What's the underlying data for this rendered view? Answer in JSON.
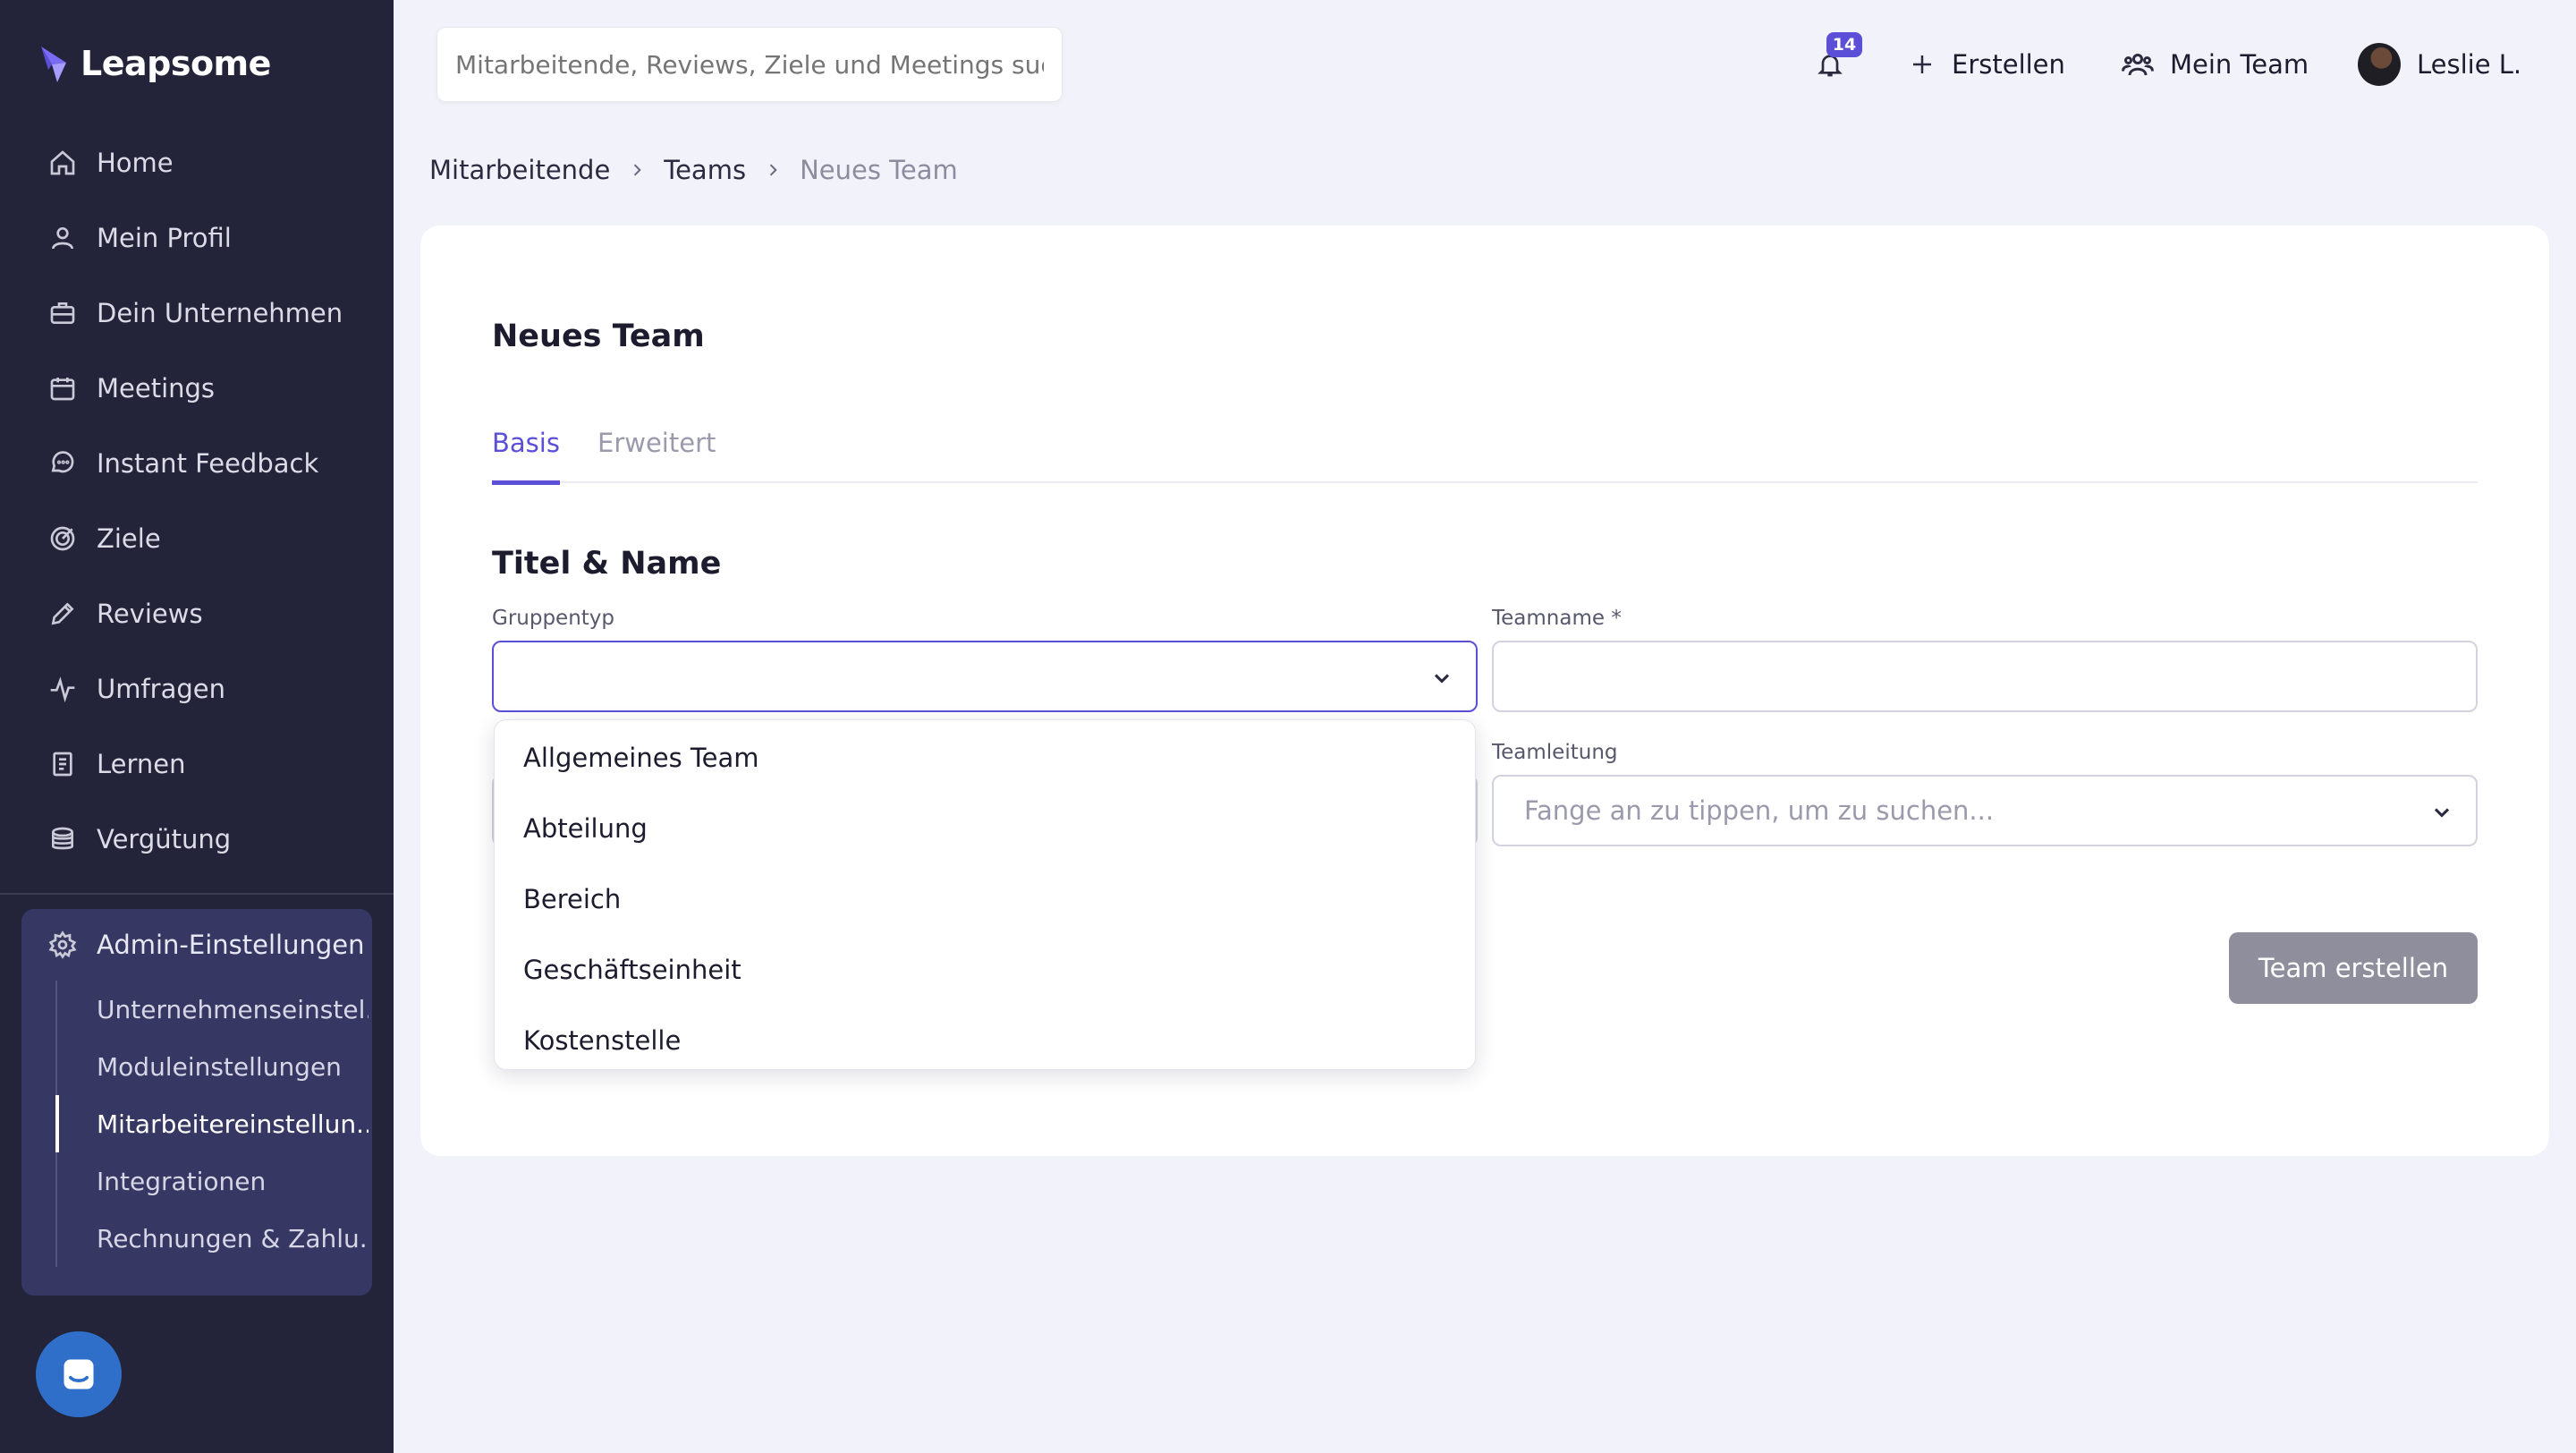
{
  "brand": {
    "name": "Leapsome"
  },
  "sidebar": {
    "items": [
      {
        "label": "Home",
        "icon": "home-icon"
      },
      {
        "label": "Mein Profil",
        "icon": "user-icon"
      },
      {
        "label": "Dein Unternehmen",
        "icon": "briefcase-icon"
      },
      {
        "label": "Meetings",
        "icon": "calendar-icon"
      },
      {
        "label": "Instant Feedback",
        "icon": "chat-bubble-icon"
      },
      {
        "label": "Ziele",
        "icon": "target-icon"
      },
      {
        "label": "Reviews",
        "icon": "pencil-icon"
      },
      {
        "label": "Umfragen",
        "icon": "pulse-icon"
      },
      {
        "label": "Lernen",
        "icon": "book-icon"
      },
      {
        "label": "Vergütung",
        "icon": "coins-icon"
      }
    ],
    "admin": {
      "label": "Admin-Einstellungen",
      "icon": "gear-icon",
      "sub_items": [
        {
          "label": "Unternehmenseinstel..."
        },
        {
          "label": "Moduleinstellungen"
        },
        {
          "label": "Mitarbeitereinstellun...",
          "active": true
        },
        {
          "label": "Integrationen"
        },
        {
          "label": "Rechnungen & Zahlu..."
        }
      ]
    }
  },
  "topbar": {
    "search_placeholder": "Mitarbeitende, Reviews, Ziele und Meetings suchen",
    "notifications_count": "14",
    "create_label": "Erstellen",
    "my_team_label": "Mein Team",
    "user_name": "Leslie L."
  },
  "breadcrumb": [
    "Mitarbeitende",
    "Teams",
    "Neues Team"
  ],
  "form": {
    "title": "Neues Team",
    "tabs": [
      "Basis",
      "Erweitert"
    ],
    "active_tab": "Basis",
    "section_title": "Titel & Name",
    "group_type_label": "Gruppentyp",
    "group_type_value": "",
    "group_type_options": [
      "Allgemeines Team",
      "Abteilung",
      "Bereich",
      "Geschäftseinheit",
      "Kostenstelle"
    ],
    "team_name_label": "Teamname *",
    "team_name_value": "",
    "team_lead_label": "Teamleitung",
    "team_lead_placeholder": "Fange an zu tippen, um zu suchen...",
    "submit_label": "Team erstellen"
  },
  "colors": {
    "sidebar_bg": "#232339",
    "admin_bg": "#363763",
    "accent": "#5b4fd8",
    "page_bg": "#f2f3fa",
    "disabled_button": "#8e8e9c",
    "chat_button": "#2f6fc9"
  }
}
